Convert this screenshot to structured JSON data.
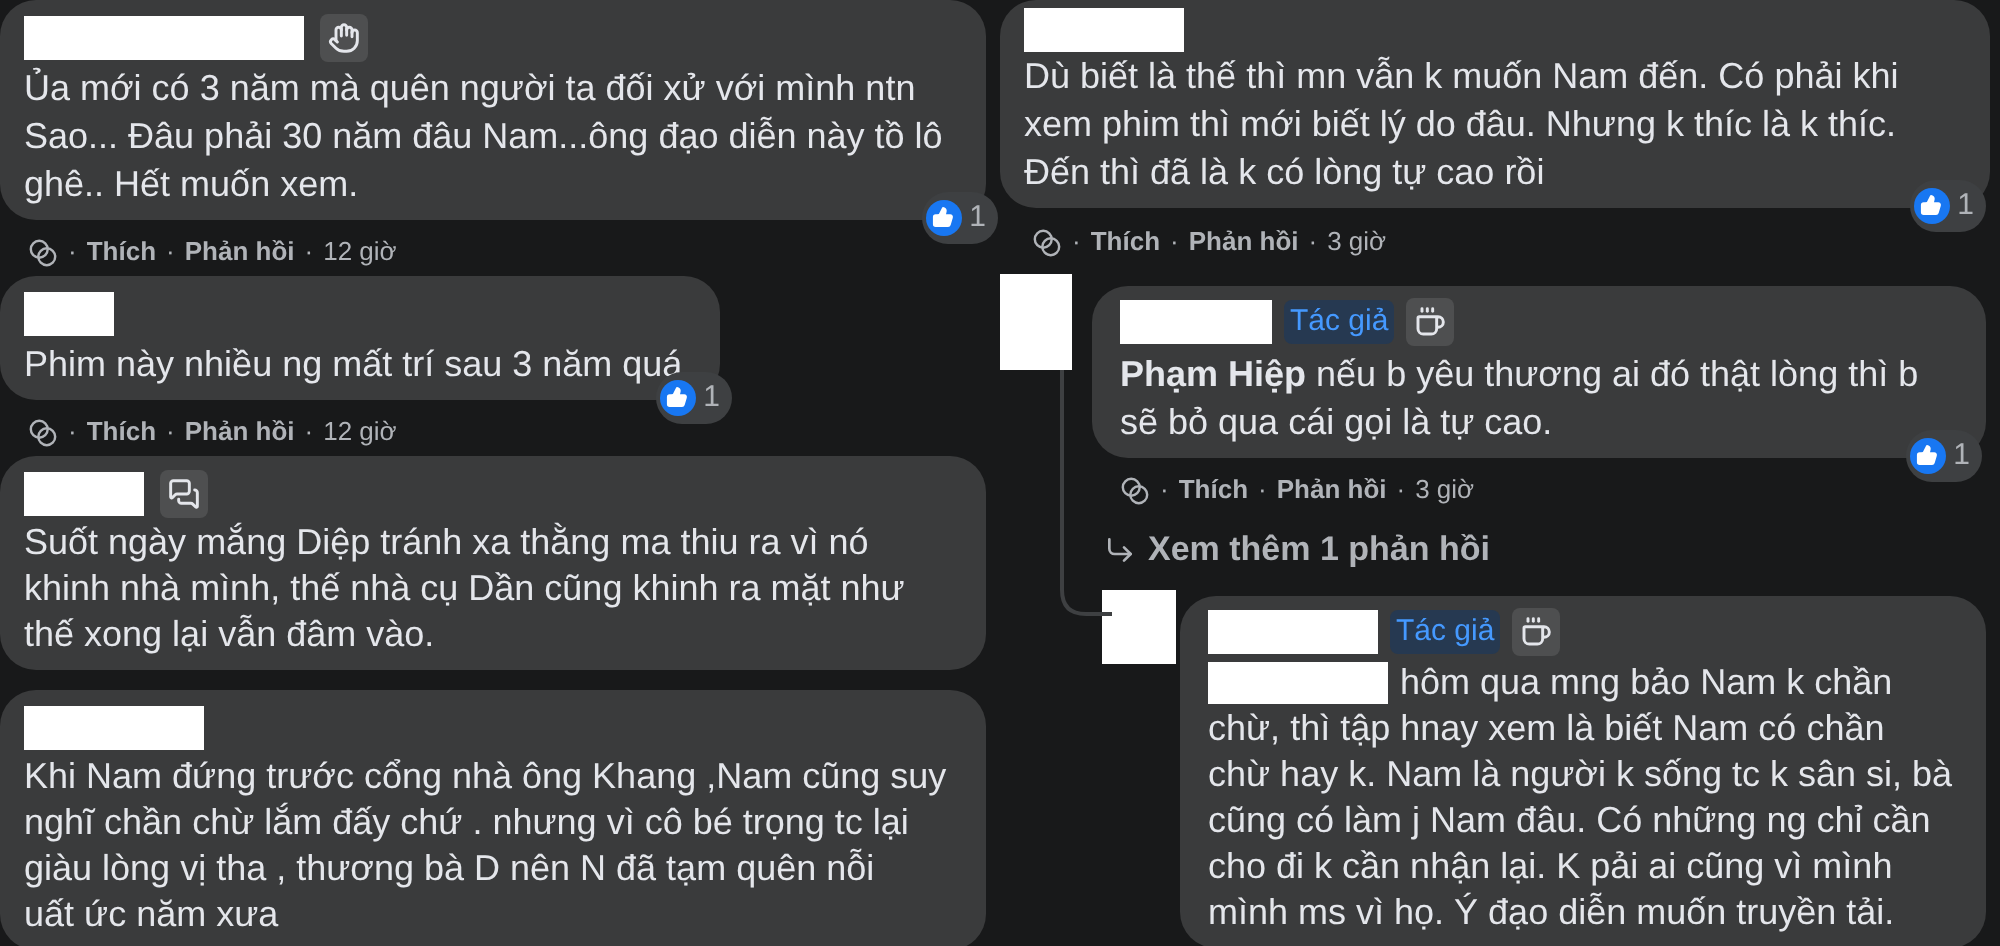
{
  "separator": "·",
  "left_comments": [
    {
      "badge": {
        "kind": "wave"
      },
      "text": "Ủa mới có 3 năm mà quên người ta đối xử với mình ntn\nSao... Đâu phải 30 năm đâu Nam...ông đạo diễn này tồ lô\nghê.. Hết muốn xem.",
      "reactions": "1",
      "actions": [
        "Thích",
        "Phản hồi",
        "12 giờ"
      ]
    },
    {
      "text": "Phim này nhiều ng mất trí sau 3 năm quá",
      "reactions": "1",
      "actions": [
        "Thích",
        "Phản hồi",
        "12 giờ"
      ]
    },
    {
      "badge": {
        "kind": "chat"
      },
      "text": "Suốt ngày mắng Diệp tránh xa thằng ma thiu ra vì nó\nkhinh nhà mình, thế nhà cụ Dần cũng khinh ra mặt như\nthế xong lại vẫn đâm vào."
    },
    {
      "text": "Khi Nam đứng trước cổng nhà ông Khang ,Nam cũng suy\nnghĩ chần chừ lắm đấy chứ . nhưng vì cô bé trọng tc lại\ngiàu lòng vị tha , thương bà D nên N đã tạm quên nỗi\nuất ức năm xưa"
    }
  ],
  "right_comment": {
    "text": "Dù biết là thế thì mn vẫn k muốn Nam đến. Có phải khi\nxem phim thì mới biết lý do đâu. Nhưng k thíc là k thíc.\nĐến thì đã là k có lòng tự cao rồi",
    "reactions": "1",
    "actions": [
      "Thích",
      "Phản hồi",
      "3 giờ"
    ]
  },
  "replies": [
    {
      "author_badge": "Tác giả",
      "badge": {
        "kind": "coffee"
      },
      "text": "**Phạm Hiệp** nếu b yêu thương ai đó thật lòng thì b\nsẽ bỏ qua cái gọi là tự cao.",
      "reactions": "1",
      "actions": [
        "Thích",
        "Phản hồi",
        "3 giờ"
      ]
    },
    {
      "author_badge": "Tác giả",
      "badge": {
        "kind": "coffee"
      },
      "tagged": true,
      "text": "hôm qua mng bảo Nam k chần\nchừ, thì tập hnay xem là biết Nam có chần\nchừ hay k. Nam là người k sống tc k sân si, bà\ncũng có làm j Nam đâu. Có những ng chỉ cần\ncho đi k cần nhận lại. K pải ai cũng vì mình\nmình ms vì họ. Ý đạo diễn muốn truyền tải."
    }
  ],
  "more_replies": "Xem thêm 1 phản hồi"
}
